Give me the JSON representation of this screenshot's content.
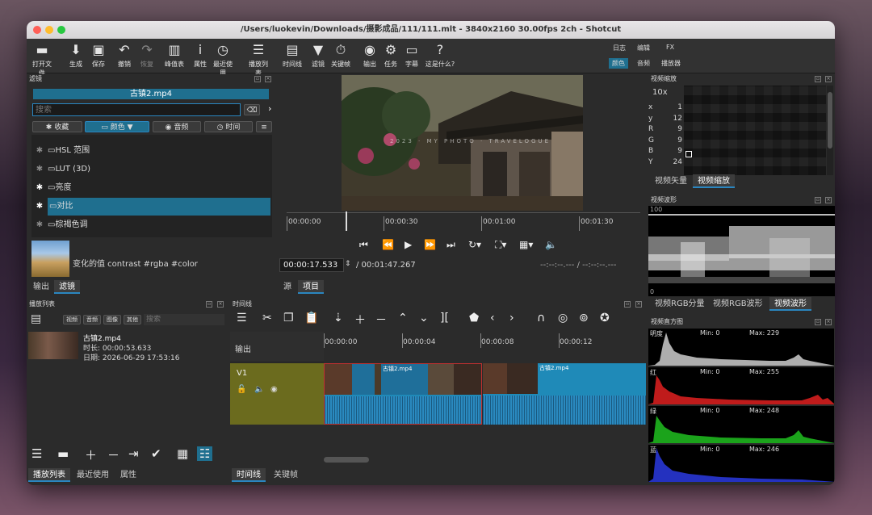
{
  "window": {
    "title": "/Users/luokevin/Downloads/摄影成品/111/111.mlt - 3840x2160 30.00fps 2ch - Shotcut"
  },
  "toolbar": {
    "items": [
      {
        "id": "open",
        "label": "打开文件",
        "icon": "folder-icon",
        "glyph": "▬"
      },
      {
        "id": "export",
        "label": "生成",
        "icon": "export-icon",
        "glyph": "⬇"
      },
      {
        "id": "save",
        "label": "保存",
        "icon": "save-icon",
        "glyph": "▣"
      },
      {
        "id": "undo",
        "label": "撤销",
        "icon": "undo-icon",
        "glyph": "↶"
      },
      {
        "id": "redo",
        "label": "恢复",
        "icon": "redo-icon",
        "glyph": "↷"
      },
      {
        "id": "peak",
        "label": "峰值表",
        "icon": "peak-meter-icon",
        "glyph": "▥"
      },
      {
        "id": "props",
        "label": "属性",
        "icon": "info-icon",
        "glyph": "i"
      },
      {
        "id": "recent",
        "label": "最近使用",
        "icon": "clock-icon",
        "glyph": "◷"
      },
      {
        "id": "playlist",
        "label": "播放列表",
        "icon": "list-icon",
        "glyph": "☰"
      },
      {
        "id": "timeline",
        "label": "时间线",
        "icon": "timeline-icon",
        "glyph": "▤"
      },
      {
        "id": "filters",
        "label": "滤镜",
        "icon": "filter-icon",
        "glyph": "▼"
      },
      {
        "id": "keyframes",
        "label": "关键帧",
        "icon": "stopwatch-icon",
        "glyph": "⏱"
      },
      {
        "id": "output",
        "label": "输出",
        "icon": "disc-icon",
        "glyph": "◉"
      },
      {
        "id": "jobs",
        "label": "任务",
        "icon": "gear-icon",
        "glyph": "⚙"
      },
      {
        "id": "subtitles",
        "label": "字幕",
        "icon": "subtitle-icon",
        "glyph": "▭"
      },
      {
        "id": "help",
        "label": "这是什么?",
        "icon": "help-icon",
        "glyph": "?"
      }
    ],
    "layouts_top": [
      "日志",
      "编辑",
      "FX"
    ],
    "layouts_bottom": [
      "颜色",
      "音频",
      "播放器"
    ]
  },
  "filters": {
    "title": "滤镜",
    "clip": "古镇2.mp4",
    "search_placeholder": "搜索",
    "cats": [
      "收藏",
      "颜色",
      "音频",
      "时间"
    ],
    "items": [
      "HSL 范围",
      "LUT (3D)",
      "亮度",
      "对比",
      "棕褐色调"
    ],
    "desc": "变化的值 contrast #rgba #color",
    "tabs": [
      "输出",
      "滤镜"
    ]
  },
  "player": {
    "tc_labels": [
      "00:00:00",
      "00:00:30",
      "00:01:00",
      "00:01:30"
    ],
    "position": "00:00:17.533",
    "duration": "/ 00:01:47.267",
    "in_out": "--:--:--.--- / --:--:--.---",
    "tabs": [
      "源",
      "项目"
    ],
    "watermark": "2023 · MY PHOTO · TRAVELOGUE"
  },
  "zoom": {
    "title": "视频缩放",
    "level": "10x",
    "x": "1",
    "y": "12",
    "r": "9",
    "g": "9",
    "b": "9",
    "yy": "24",
    "tabs": [
      "视频矢量",
      "视频缩放"
    ]
  },
  "waveform": {
    "title": "视频波形",
    "top": "100",
    "bottom": "0",
    "tabs": [
      "视频RGB分量",
      "视频RGB波形",
      "视频波形"
    ]
  },
  "histogram": {
    "title": "视频直方图",
    "rows": [
      {
        "name": "明度",
        "min": "Min: 0",
        "max": "Max: 229",
        "color": "#cccccc"
      },
      {
        "name": "红",
        "min": "Min: 0",
        "max": "Max: 255",
        "color": "#e02020"
      },
      {
        "name": "绿",
        "min": "Min: 0",
        "max": "Max: 248",
        "color": "#20c020"
      },
      {
        "name": "蓝",
        "min": "Min: 0",
        "max": "Max: 246",
        "color": "#2a3ae0"
      }
    ]
  },
  "playlist": {
    "title": "播放列表",
    "filters": [
      "视频",
      "音频",
      "图像",
      "其他"
    ],
    "search_placeholder": "搜索",
    "item": {
      "name": "古镇2.mp4",
      "duration": "时长: 00:00:53.633",
      "date": "日期: 2026-06-29 17:53:16"
    },
    "tabs": [
      "播放列表",
      "最近使用",
      "属性"
    ]
  },
  "timeline": {
    "title": "时间线",
    "output": "输出",
    "track": "V1",
    "ticks": [
      "00:00:00",
      "00:00:04",
      "00:00:08",
      "00:00:12"
    ],
    "clip1": "古镇2.mp4",
    "clip2": "古镇2.mp4",
    "tabs": [
      "时间线",
      "关键帧"
    ]
  },
  "colors": {
    "accent": "#2a86c0",
    "selection": "#1f6f8f",
    "track": "#6b6b1e",
    "clip": "#1f8ab8"
  }
}
